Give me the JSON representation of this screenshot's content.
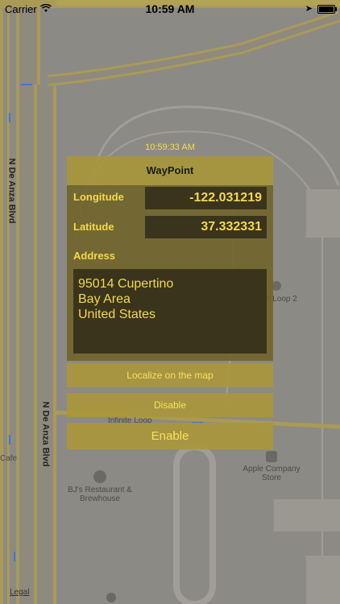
{
  "status_bar": {
    "carrier": "Carrier",
    "time": "10:59 AM"
  },
  "map": {
    "roads": [
      "N De Anza Blvd",
      "N De Anza Blvd",
      "Infinite Loop"
    ],
    "places": [
      {
        "name": "Infinite Loop 2"
      },
      {
        "name": "Apple Company Store"
      },
      {
        "name": "BJ's Restaurant & Brewhouse"
      },
      {
        "name": "Cafe"
      }
    ],
    "legal": "Legal"
  },
  "waypoint": {
    "timestamp": "10:59:33 AM",
    "title": "WayPoint",
    "longitude_label": "Longitude",
    "longitude_value": "-122.031219",
    "latitude_label": "Latitude",
    "latitude_value": "37.332331",
    "address_label": "Address",
    "address_lines": [
      "95014 Cupertino",
      "Bay Area",
      "United States"
    ]
  },
  "buttons": {
    "localize": "Localize on the map",
    "disable": "Disable",
    "enable": "Enable"
  },
  "colors": {
    "accent": "#f4d84a",
    "panel_dark": "#706428",
    "panel_title": "#a89638",
    "map": "#8c8a85"
  }
}
